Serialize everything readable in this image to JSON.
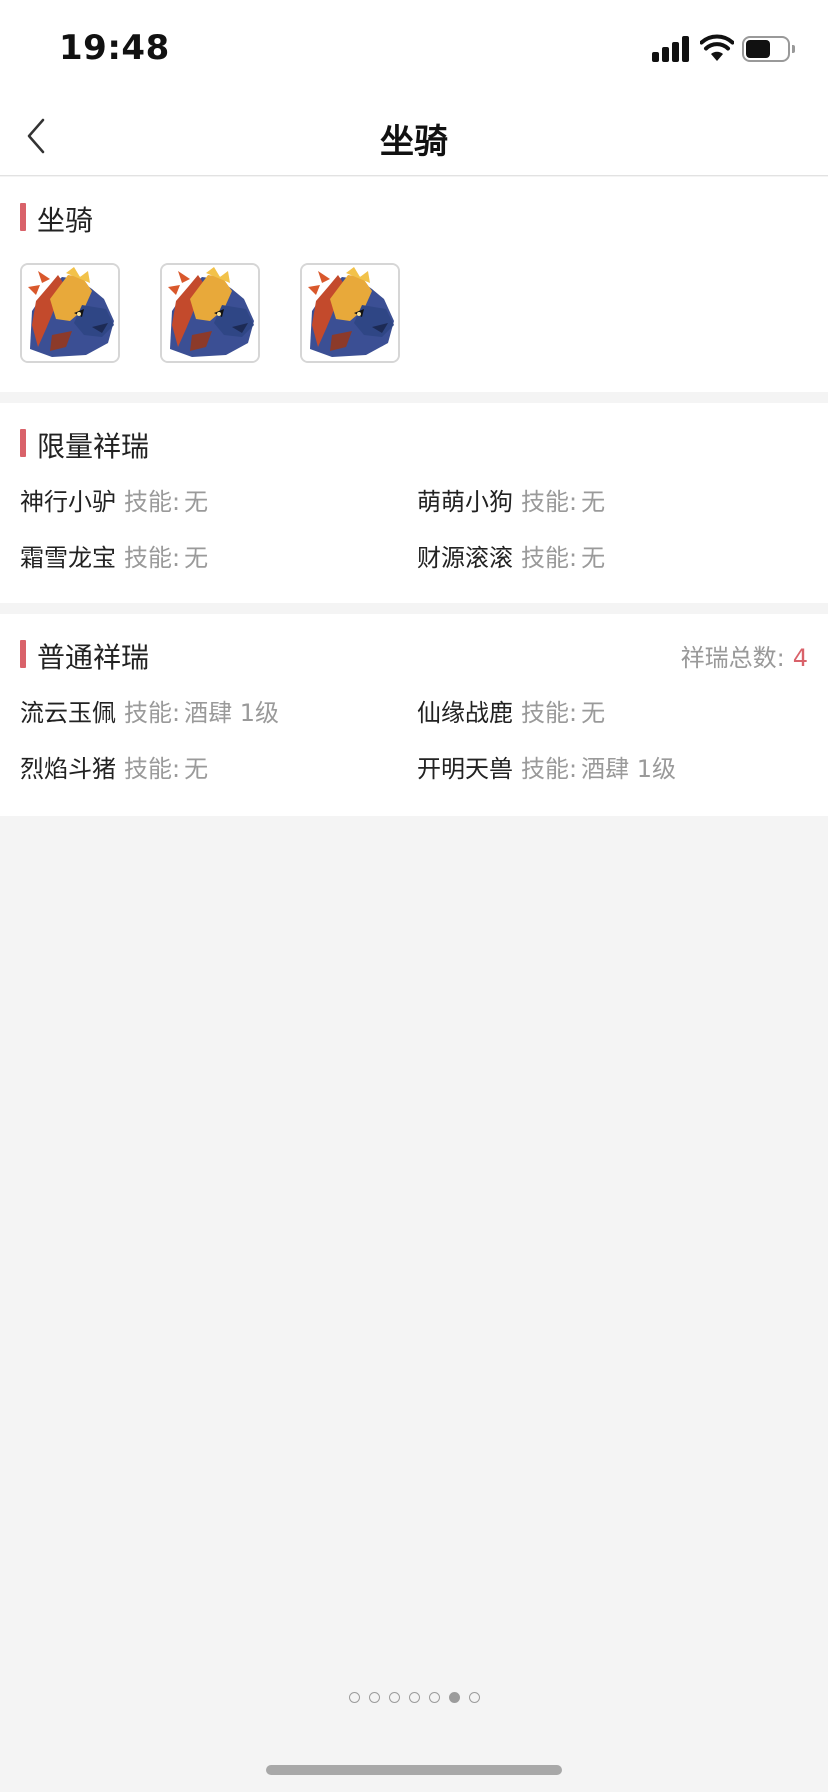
{
  "status_bar": {
    "time": "19:48"
  },
  "nav": {
    "title": "坐骑"
  },
  "mounts_section": {
    "title": "坐骑",
    "thumbnails": [
      "mount-1",
      "mount-2",
      "mount-3"
    ]
  },
  "limited_section": {
    "title": "限量祥瑞",
    "skill_label": "技能:",
    "items": [
      {
        "name": "神行小驴",
        "skill": "无"
      },
      {
        "name": "萌萌小狗",
        "skill": "无"
      },
      {
        "name": "霜雪龙宝",
        "skill": "无"
      },
      {
        "name": "财源滚滚",
        "skill": "无"
      }
    ]
  },
  "normal_section": {
    "title": "普通祥瑞",
    "total_label": "祥瑞总数:",
    "total_value": "4",
    "skill_label": "技能:",
    "items": [
      {
        "name": "流云玉佩",
        "skill": "酒肆 1级"
      },
      {
        "name": "仙缘战鹿",
        "skill": "无"
      },
      {
        "name": "烈焰斗猪",
        "skill": "无"
      },
      {
        "name": "开明天兽",
        "skill": "酒肆 1级"
      }
    ]
  },
  "pager": {
    "count": 7,
    "active_index": 5
  },
  "colors": {
    "accent": "#d9626a",
    "muted": "#9a9a9a",
    "background": "#f4f4f4"
  },
  "icons": [
    "signal-icon",
    "wifi-icon",
    "battery-icon",
    "back-chevron-icon"
  ]
}
